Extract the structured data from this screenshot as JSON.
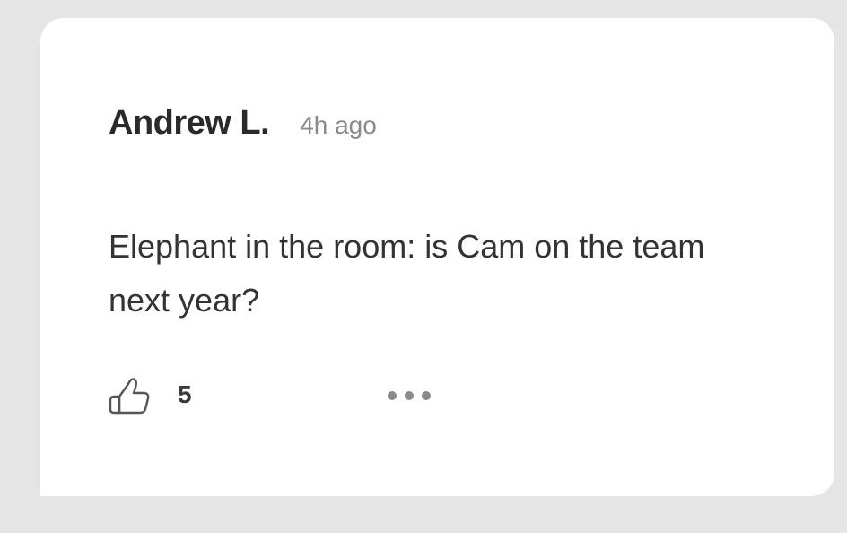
{
  "comment": {
    "author": "Andrew L.",
    "time": "4h ago",
    "text": "Elephant in the room: is Cam on the team next year?",
    "likes": "5"
  },
  "icons": {
    "like": "thumbs-up-icon",
    "more": "more-horizontal-icon"
  },
  "colors": {
    "page_background": "#e5e5e5",
    "card_background": "#ffffff",
    "author_text": "#2a2a2a",
    "meta_text": "#8a8a8a",
    "body_text": "#333333",
    "icon_stroke": "#555555",
    "dots": "#8a8a8a"
  }
}
